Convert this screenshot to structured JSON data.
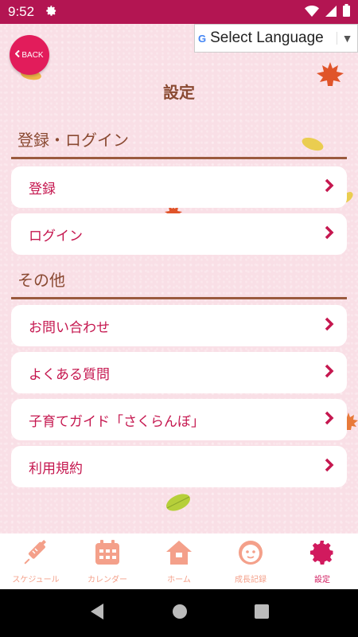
{
  "status_bar": {
    "time": "9:52",
    "icons": [
      "settings-gear-icon",
      "wifi-icon",
      "signal-icon",
      "battery-icon"
    ]
  },
  "header": {
    "back_label": "BACK",
    "language_select": "Select Language",
    "title": "設定"
  },
  "sections": [
    {
      "heading": "登録・ログイン",
      "items": [
        "登録",
        "ログイン"
      ]
    },
    {
      "heading": "その他",
      "items": [
        "お問い合わせ",
        "よくある質問",
        "子育てガイド「さくらんぼ」",
        "利用規約"
      ]
    }
  ],
  "tabs": [
    {
      "label": "スケジュール",
      "icon": "syringe-icon",
      "active": false
    },
    {
      "label": "カレンダー",
      "icon": "calendar-icon",
      "active": false
    },
    {
      "label": "ホーム",
      "icon": "home-icon",
      "active": false
    },
    {
      "label": "成長記録",
      "icon": "baby-face-icon",
      "active": false
    },
    {
      "label": "設定",
      "icon": "gear-icon",
      "active": true
    }
  ],
  "colors": {
    "status_bar": "#b31552",
    "accent": "#c5174f",
    "heading_brown": "#8a4a32",
    "background": "#f9dfe6",
    "tab_inactive": "#f4a08a",
    "tab_active": "#d11a5e"
  }
}
